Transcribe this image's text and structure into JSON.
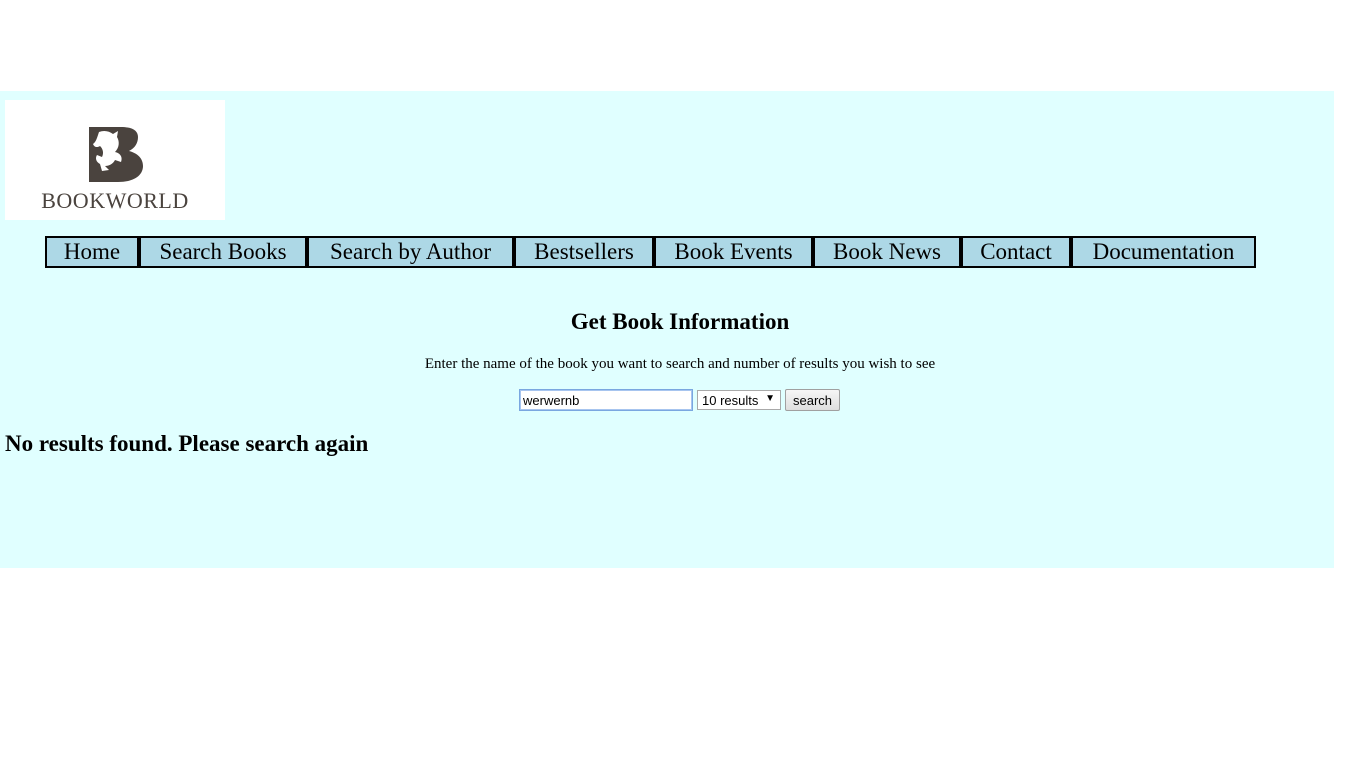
{
  "logo": {
    "text": "BookWorld",
    "icon": "horse-b-logo-icon",
    "color": "#4a433e"
  },
  "nav": {
    "items": [
      {
        "label": "Home"
      },
      {
        "label": "Search Books"
      },
      {
        "label": "Search by Author"
      },
      {
        "label": "Bestsellers"
      },
      {
        "label": "Book Events"
      },
      {
        "label": "Book News"
      },
      {
        "label": "Contact"
      },
      {
        "label": "Documentation"
      }
    ]
  },
  "main": {
    "heading": "Get Book Information",
    "instructions": "Enter the name of the book you want to search and number of results you wish to see",
    "search": {
      "value": "werwernb",
      "results_selected": "10 results",
      "button_label": "search"
    },
    "message": "No results found. Please search again"
  },
  "colors": {
    "background": "#e0ffff",
    "nav_item": "#add8e6",
    "nav_border": "#000000"
  }
}
